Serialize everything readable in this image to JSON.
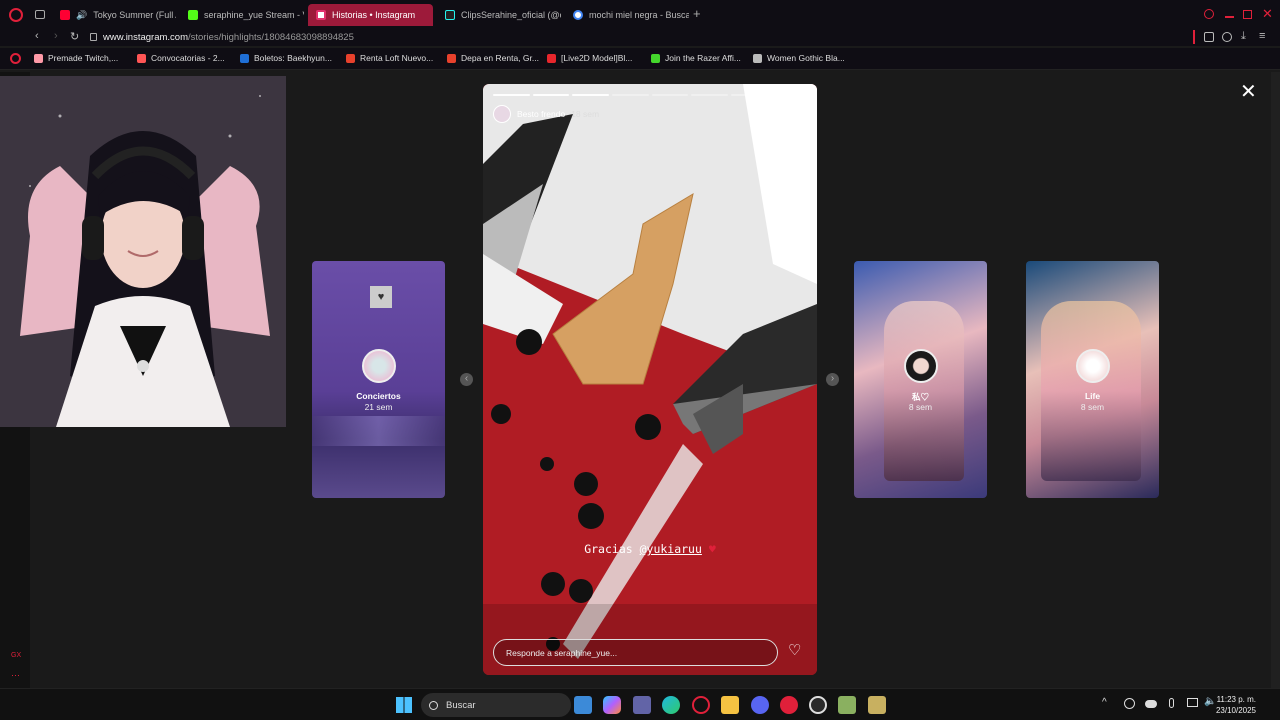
{
  "browser": {
    "tabs": [
      {
        "label": "Tokyo Summer (Full A",
        "color": "#ff0033"
      },
      {
        "label": "seraphine_yue Stream - V",
        "color": "#53fc18"
      },
      {
        "label": "Historias • Instagram",
        "color": "#e1306c",
        "active": true
      },
      {
        "label": "ClipsSerahine_oficial (@c",
        "color": "#25f4ee"
      },
      {
        "label": "mochi miel negra - Busca",
        "color": "#4285f4"
      }
    ],
    "url_host": "www.instagram.com",
    "url_path": "/stories/highlights/18084683098894825",
    "bookmarks": [
      {
        "label": "Premade Twitch,...",
        "color": "#ff9aa8"
      },
      {
        "label": "Convocatorias - 2...",
        "color": "#ff5555"
      },
      {
        "label": "Boletos: Baekhyun...",
        "color": "#1f6fd6"
      },
      {
        "label": "Renta Loft Nuevo...",
        "color": "#e8412c"
      },
      {
        "label": "Depa en Renta, Gr...",
        "color": "#e8412c"
      },
      {
        "label": "[Live2D Model]Bl...",
        "color": "#e8262c"
      },
      {
        "label": "Join the Razer Affi...",
        "color": "#44d62c"
      },
      {
        "label": "Women Gothic Bla...",
        "color": "#bbbbbb"
      }
    ]
  },
  "story": {
    "username": "Besto frendo",
    "time": "18 sem",
    "caption_text": "Gracias ",
    "caption_mention": "@yukiaruu",
    "caption_heart": "♥",
    "reply_placeholder": "Responde a seraphine_yue...",
    "segments_total": 8,
    "segments_done": 3
  },
  "highlights": [
    {
      "name": "Conciertos",
      "time": "21 sem"
    },
    {
      "name": "私♡",
      "time": "8 sem"
    },
    {
      "name": "Life",
      "time": "8 sem"
    }
  ],
  "taskbar": {
    "search_label": "Buscar",
    "time": "11:23 p. m.",
    "date": "23/10/2025"
  }
}
